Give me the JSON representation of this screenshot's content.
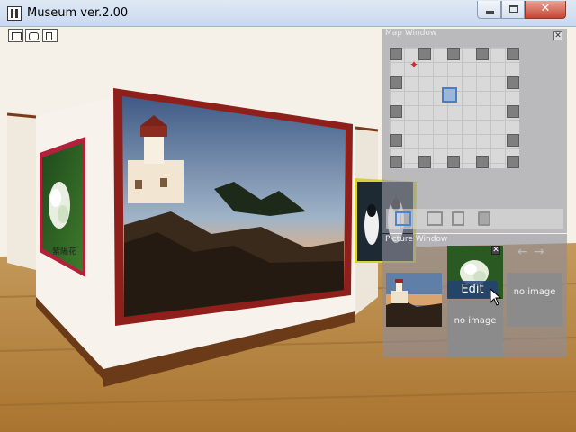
{
  "window": {
    "title": "Museum ver.2.00",
    "controls": {
      "minimize": "",
      "maximize": "",
      "close": "✕"
    }
  },
  "scene": {
    "toolbar": [
      "save-view-icon",
      "camera-icon",
      "exit-icon"
    ],
    "picture_labels": {
      "flower_frame": "紫陽花"
    },
    "colors": {
      "frame_red": "#8e1f1b",
      "frame_crimson": "#b3203c",
      "frame_yellow": "#d7d23b",
      "floor": "#b98a4a",
      "wall": "#f4efe6"
    }
  },
  "map_window": {
    "title": "Map Window",
    "close": "✕",
    "tools": [
      "wall-tool-icon",
      "frame-tool-icon",
      "door-tool-icon",
      "box-tool-icon"
    ]
  },
  "picture_window": {
    "title": "Picture Window",
    "close": "✕",
    "edit_label": "Edit",
    "no_image_label": "no image",
    "prev_icon": "←",
    "next_icon": "→"
  }
}
